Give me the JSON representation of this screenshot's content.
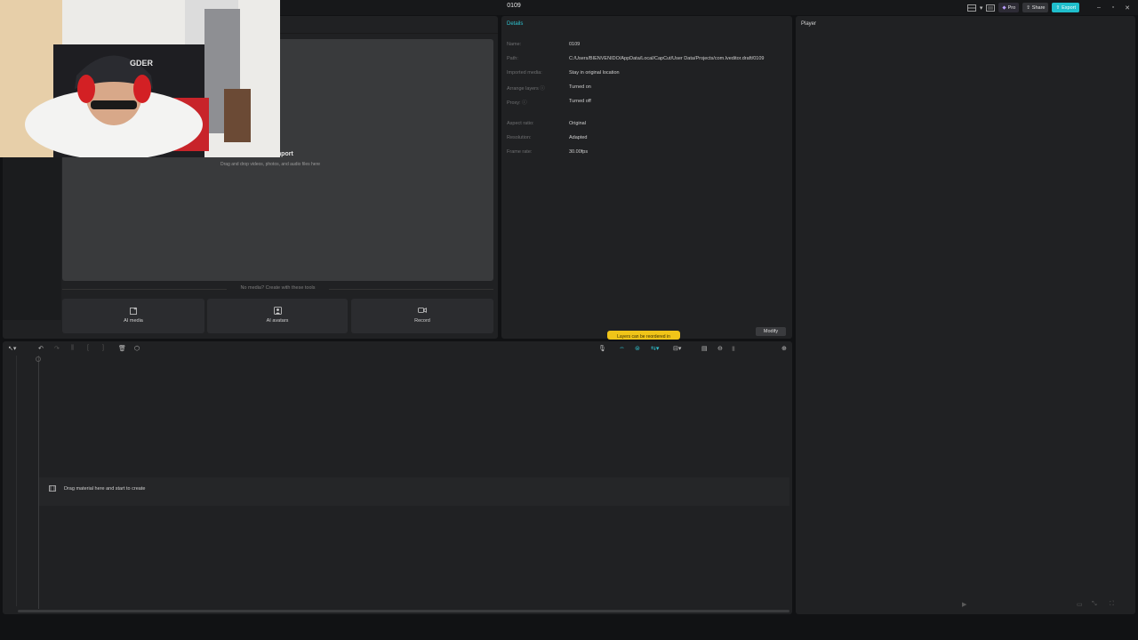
{
  "window": {
    "title": "0109"
  },
  "titlebar": {
    "pro_label": "Pro",
    "share_label": "Share",
    "export_label": "Export"
  },
  "media": {
    "import_title": "Import",
    "import_hint": "Drag and drop videos, photos, and audio files here",
    "no_media_text": "No media? Create with these tools",
    "tools": [
      {
        "label": "AI media",
        "icon": "ai-media-icon"
      },
      {
        "label": "AI avatars",
        "icon": "ai-avatar-icon"
      },
      {
        "label": "Record",
        "icon": "record-icon"
      }
    ]
  },
  "details": {
    "tab_label": "Details",
    "rows": [
      {
        "label": "Name:",
        "value": "0109"
      },
      {
        "label": "Path:",
        "value": "C:/Users/BIENVENIDO/AppData/Local/CapCut/User Data/Projects/com.lveditor.draft/0109"
      },
      {
        "label": "Imported media:",
        "value": "Stay in original location"
      },
      {
        "label": "Arrange layers ⓘ",
        "value": "Turned on"
      },
      {
        "label": "Proxy: ⓘ",
        "value": "Turned off"
      },
      {
        "label": "Aspect ratio:",
        "value": "Original"
      },
      {
        "label": "Resolution:",
        "value": "Adapted"
      },
      {
        "label": "Frame rate:",
        "value": "30.00fps"
      }
    ],
    "modify_label": "Modify",
    "toast_text": "Layers can be reordered in"
  },
  "player": {
    "title": "Player"
  },
  "timeline": {
    "drop_text": "Drag material here and start to create"
  },
  "colors": {
    "accent": "#2fc4d1",
    "export_bg": "#1fbecc",
    "toast_bg": "#f0c419",
    "panel_bg": "#202123",
    "app_bg": "#111214"
  }
}
